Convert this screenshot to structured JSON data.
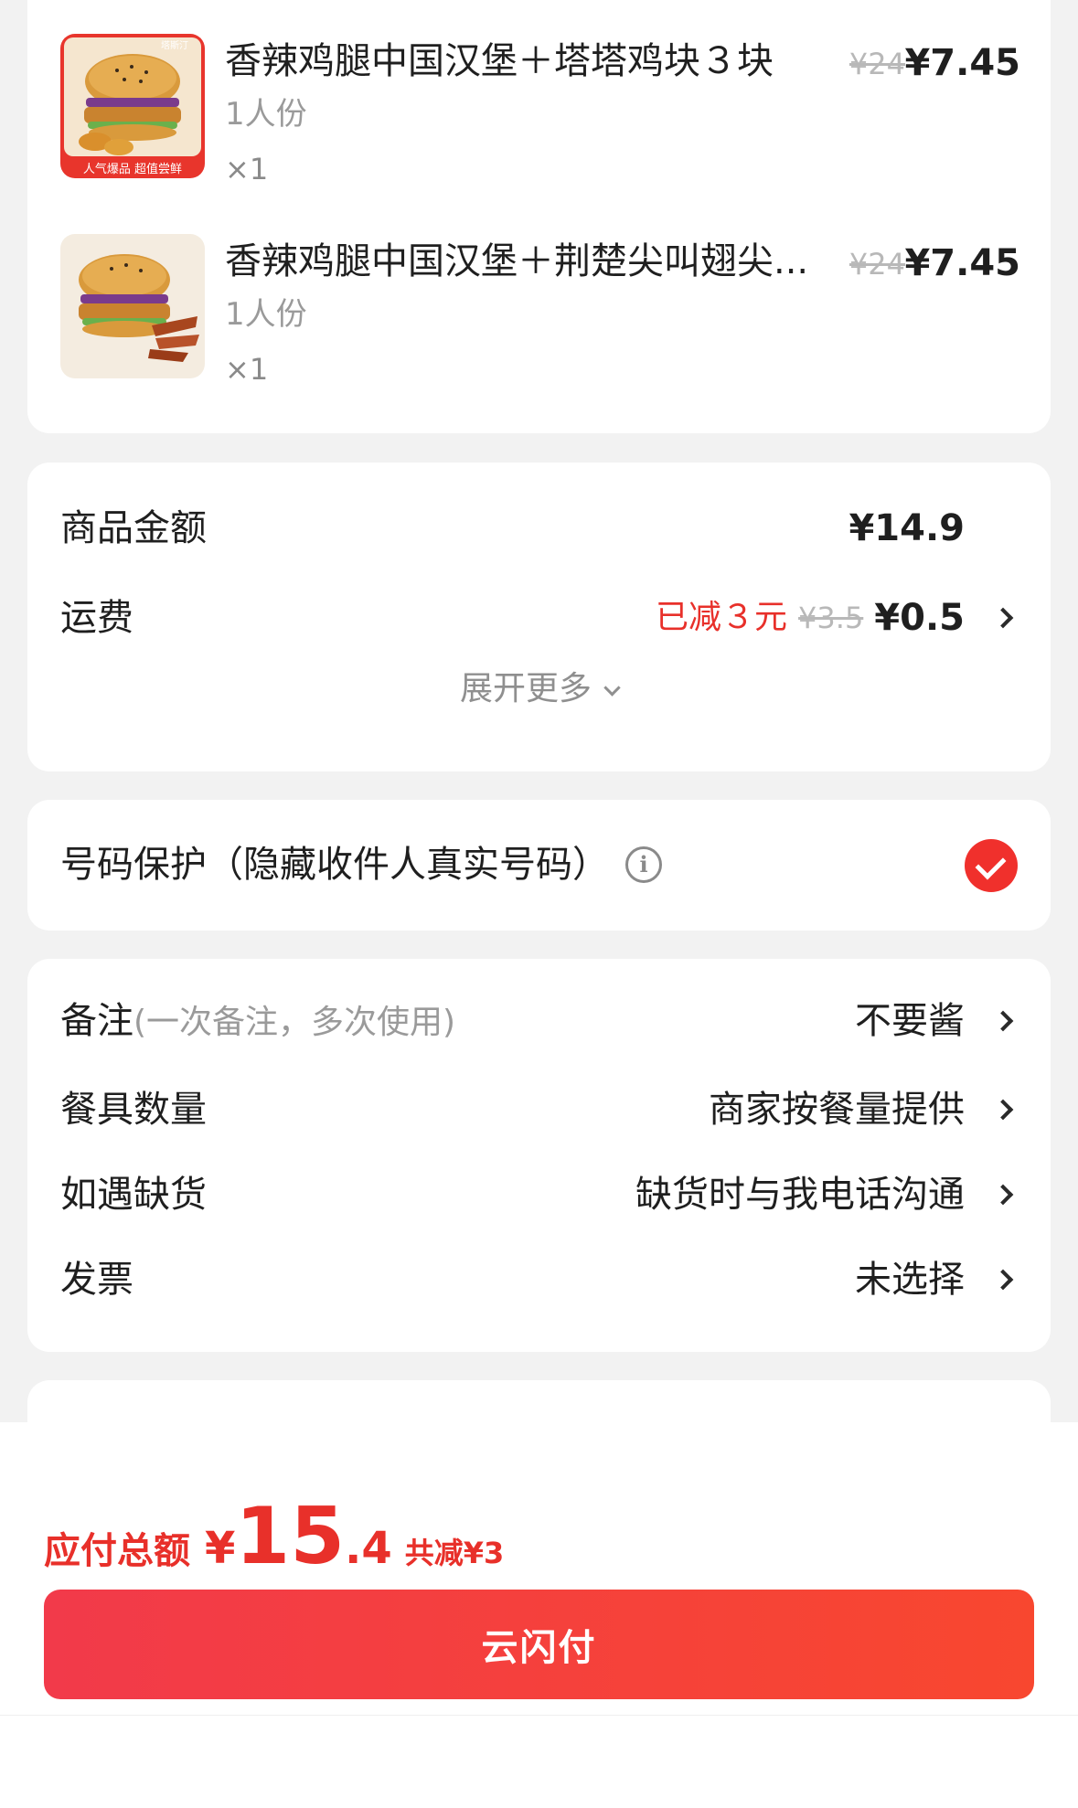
{
  "items": [
    {
      "name": "香辣鸡腿中国汉堡＋塔塔鸡块３块",
      "spec": "1人份",
      "qty": "×1",
      "orig_price": "¥24",
      "price": "¥7.45",
      "thumb_banner": "人气爆品 超值尝鲜",
      "thumb_brand": "塔斯汀"
    },
    {
      "name": "香辣鸡腿中国汉堡＋荆楚尖叫翅尖...",
      "spec": "1人份",
      "qty": "×1",
      "orig_price": "¥24",
      "price": "¥7.45"
    }
  ],
  "amount": {
    "goods_label": "商品金额",
    "goods_value": "¥14.9",
    "shipping_label": "运费",
    "shipping_discount": "已减３元",
    "shipping_orig": "¥3.5",
    "shipping_value": "¥0.5",
    "expand_label": "展开更多"
  },
  "privacy": {
    "label": "号码保护（隐藏收件人真实号码）",
    "info_icon": "i",
    "checked": true
  },
  "options": {
    "remark_label": "备注",
    "remark_hint": "(一次备注，多次使用)",
    "remark_value": "不要酱",
    "tableware_label": "餐具数量",
    "tableware_value": "商家按餐量提供",
    "stockout_label": "如遇缺货",
    "stockout_value": "缺货时与我电话沟通",
    "invoice_label": "发票",
    "invoice_value": "未选择"
  },
  "bottom": {
    "total_label": "应付总额",
    "currency": "¥",
    "total_int": "15",
    "total_dec": ".4",
    "saved": "共减¥3",
    "pay_label": "云闪付"
  },
  "colors": {
    "accent": "#f0302c",
    "background": "#f2f2f2"
  }
}
